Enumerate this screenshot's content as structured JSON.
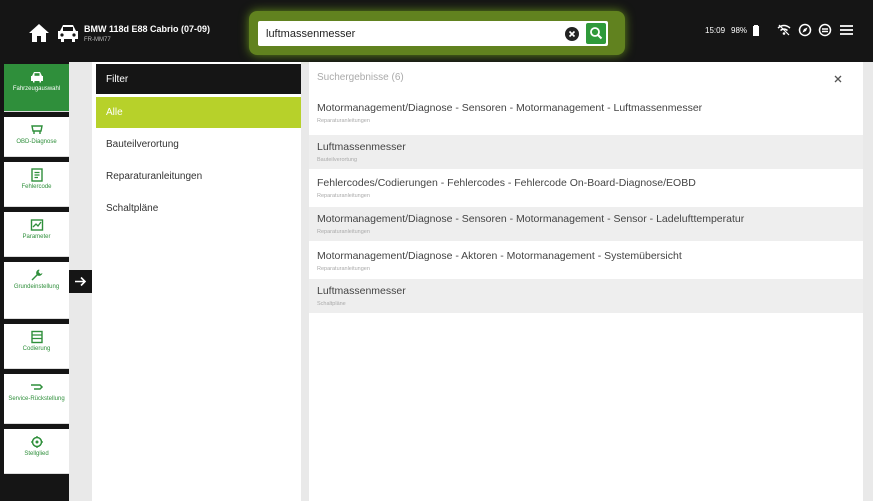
{
  "header": {
    "vehicle_title": "BMW 118d E88 Cabrio (07-09)",
    "vehicle_sub": "FR-MM77",
    "search_value": "luftmassenmesser",
    "time": "15:09",
    "battery": "98%"
  },
  "sidebar": {
    "items": [
      {
        "label": "Fahrzeugauswahl",
        "icon": "car-icon"
      },
      {
        "label": "OBD-Diagnose",
        "icon": "obd-icon"
      },
      {
        "label": "Fehlercode",
        "icon": "error-code-icon"
      },
      {
        "label": "Parameter",
        "icon": "parameter-icon"
      },
      {
        "label": "Grundeinstellung",
        "icon": "wrench-icon"
      },
      {
        "label": "Codierung",
        "icon": "coding-icon"
      },
      {
        "label": "Service-Rückstellung",
        "icon": "service-reset-icon"
      },
      {
        "label": "Stellglied",
        "icon": "actuator-icon"
      }
    ]
  },
  "filter": {
    "title": "Filter",
    "items": [
      {
        "label": "Alle"
      },
      {
        "label": "Bauteilverortung"
      },
      {
        "label": "Reparaturanleitungen"
      },
      {
        "label": "Schaltpläne"
      }
    ]
  },
  "results": {
    "header": "Suchergebnisse (6)",
    "items": [
      {
        "title": "Motormanagement/Diagnose - Sensoren - Motormanagement - Luftmassenmesser",
        "category": "Reparaturanleitungen"
      },
      {
        "title": "Luftmassenmesser",
        "category": "Bauteilverortung"
      },
      {
        "title": "Fehlercodes/Codierungen - Fehlercodes - Fehlercode On-Board-Diagnose/EOBD",
        "category": "Reparaturanleitungen"
      },
      {
        "title": "Motormanagement/Diagnose - Sensoren - Motormanagement - Sensor - Ladelufttemperatur",
        "category": "Reparaturanleitungen"
      },
      {
        "title": "Motormanagement/Diagnose - Aktoren - Motormanagement - Systemübersicht",
        "category": "Reparaturanleitungen"
      },
      {
        "title": "Luftmassenmesser",
        "category": "Schaltpläne"
      }
    ]
  },
  "colors": {
    "accent_green": "#2f8f3b",
    "filter_active": "#b7d12a",
    "dark": "#151515"
  }
}
